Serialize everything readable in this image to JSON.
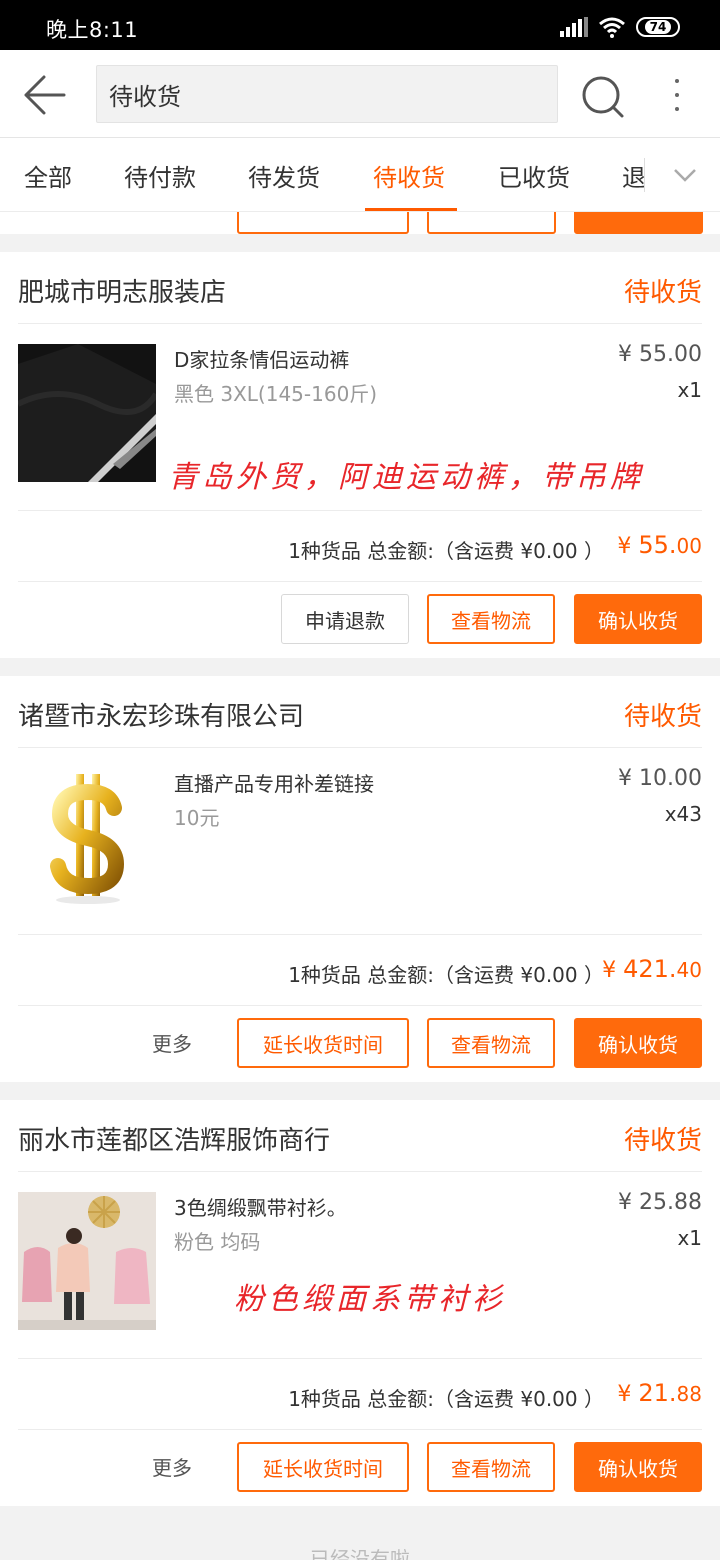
{
  "status_bar": {
    "time": "晚上8:11",
    "battery": "74"
  },
  "header": {
    "search_value": "待收货"
  },
  "tabs": [
    {
      "label": "全部"
    },
    {
      "label": "待付款"
    },
    {
      "label": "待发货"
    },
    {
      "label": "待收货",
      "active": true
    },
    {
      "label": "已收货"
    },
    {
      "label": "退"
    }
  ],
  "orders": [
    {
      "shop": "肥城市明志服装店",
      "status": "待收货",
      "product": {
        "title": "D家拉条情侣运动裤",
        "spec": "黑色 3XL(145-160斤)",
        "price": "¥ 55.00",
        "qty": "x1"
      },
      "handwritten_note": "青岛外贸，阿迪运动裤，带吊牌",
      "summary": {
        "text": "1种货品 总金额:（含运费 ¥0.00 ）",
        "yen": "¥ ",
        "total_int": "55.",
        "total_dec": "00"
      },
      "buttons": {
        "refund": "申请退款",
        "logistics": "查看物流",
        "confirm": "确认收货"
      }
    },
    {
      "shop": "诸暨市永宏珍珠有限公司",
      "status": "待收货",
      "product": {
        "title": "直播产品专用补差链接",
        "spec": "10元",
        "price": "¥ 10.00",
        "qty": "x43"
      },
      "summary": {
        "text": "1种货品 总金额:（含运费 ¥0.00 ）",
        "yen": "¥ ",
        "total_int": "421.",
        "total_dec": "40"
      },
      "buttons": {
        "more": "更多",
        "extend": "延长收货时间",
        "logistics": "查看物流",
        "confirm": "确认收货"
      }
    },
    {
      "shop": "丽水市莲都区浩辉服饰商行",
      "status": "待收货",
      "product": {
        "title": "3色绸缎飘带衬衫。",
        "spec": "粉色 均码",
        "price": "¥ 25.88",
        "qty": "x1"
      },
      "handwritten_note": "粉色缎面系带衬衫",
      "summary": {
        "text": "1种货品 总金额:（含运费 ¥0.00 ）",
        "yen": "¥ ",
        "total_int": "21.",
        "total_dec": "88"
      },
      "buttons": {
        "more": "更多",
        "extend": "延长收货时间",
        "logistics": "查看物流",
        "confirm": "确认收货"
      }
    }
  ],
  "footer": {
    "end_text": "已经没有啦"
  },
  "colors": {
    "accent": "#ff5a00",
    "button_fill": "#ff6a0c",
    "note_red": "#e8262a"
  },
  "icons": [
    "back-arrow-icon",
    "search-icon",
    "more-vertical-icon",
    "chevron-down-icon",
    "signal-icon",
    "wifi-icon",
    "battery-icon",
    "dollar-sign-icon"
  ]
}
